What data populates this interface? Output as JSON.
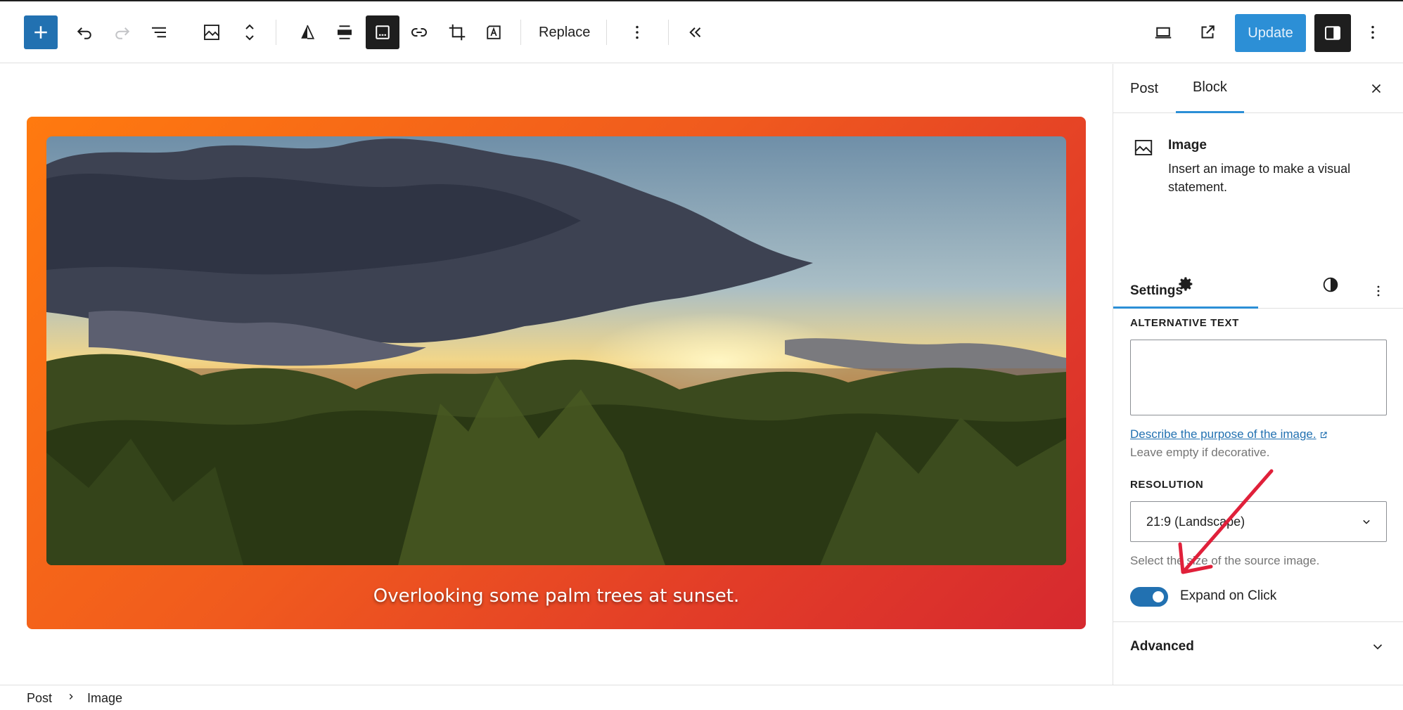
{
  "toolbar": {
    "replace_label": "Replace",
    "update_label": "Update",
    "icons": [
      "plus-icon",
      "undo-icon",
      "redo-icon",
      "list-view-icon",
      "image-icon",
      "move-up-down-icon",
      "duotone-icon",
      "align-icon",
      "caption-icon",
      "link-icon",
      "crop-icon",
      "text-overlay-icon",
      "more-vertical-icon",
      "collapse-icon",
      "desktop-preview-icon",
      "external-view-icon",
      "settings-panel-icon",
      "options-icon"
    ]
  },
  "canvas": {
    "caption": "Overlooking some palm trees at sunset.",
    "gradient_colors": [
      "#ff7a0f",
      "#d6292f"
    ]
  },
  "sidebar": {
    "tabs": [
      {
        "label": "Post",
        "active": false
      },
      {
        "label": "Block",
        "active": true
      }
    ],
    "block": {
      "title": "Image",
      "description": "Insert an image to make a visual statement."
    },
    "settings": {
      "title": "Settings",
      "alt_text_label": "ALTERNATIVE TEXT",
      "alt_text_value": "",
      "alt_link": "Describe the purpose of the image.",
      "alt_help": "Leave empty if decorative.",
      "resolution_label": "RESOLUTION",
      "resolution_value": "21:9 (Landscape)",
      "resolution_help": "Select the size of the source image.",
      "expand_label": "Expand on Click",
      "expand_on": true
    },
    "advanced_label": "Advanced"
  },
  "breadcrumb": [
    "Post",
    "Image"
  ],
  "colors": {
    "accent": "#2271b1",
    "update_button": "#2c8fd6",
    "annotation_arrow": "#e0203a"
  }
}
